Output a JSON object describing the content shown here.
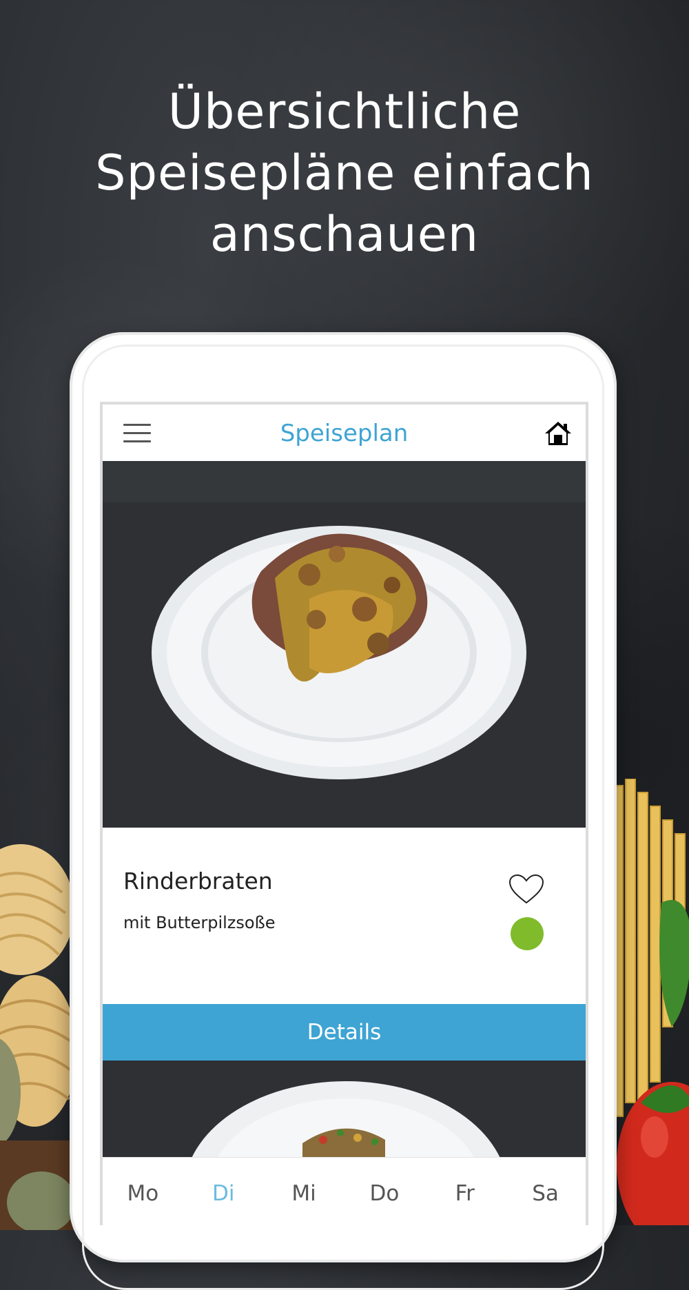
{
  "headline": {
    "line1": "Übersichtliche",
    "line2": "Speisepläne einfach",
    "line3": "anschauen"
  },
  "appbar": {
    "title": "Speiseplan",
    "menu_icon": "hamburger-menu-icon",
    "home_icon": "home-icon"
  },
  "dish": {
    "name": "Rinderbraten",
    "description": "mit Butterpilzsoße",
    "favorite_icon": "heart-outline-icon",
    "category_color": "#7fbb2b"
  },
  "details_button": {
    "label": "Details"
  },
  "day_tabs": [
    {
      "label": "Mo",
      "active": false
    },
    {
      "label": "Di",
      "active": true
    },
    {
      "label": "Mi",
      "active": false
    },
    {
      "label": "Do",
      "active": false
    },
    {
      "label": "Fr",
      "active": false
    },
    {
      "label": "Sa",
      "active": false
    }
  ],
  "colors": {
    "accent": "#3ea4d3",
    "active_tab": "#6bbbe0",
    "veg_dot": "#7fbb2b"
  }
}
